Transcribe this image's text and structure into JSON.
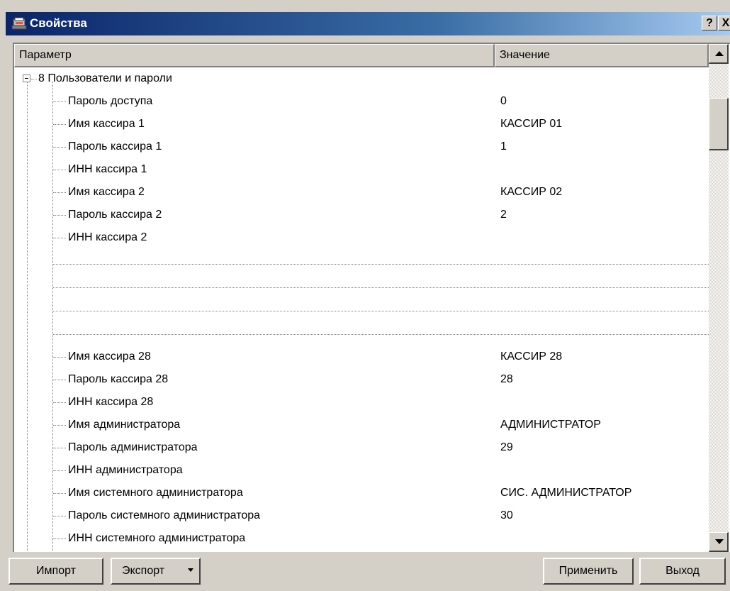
{
  "window": {
    "title": "Свойства",
    "help_label": "?",
    "close_label": "X"
  },
  "table": {
    "columns": [
      "Параметр",
      "Значение"
    ],
    "group": {
      "label": "8 Пользователи и пароли",
      "expanded": true
    },
    "rows_top": [
      {
        "param": "Пароль доступа",
        "value": "0"
      },
      {
        "param": "Имя кассира 1",
        "value": "КАССИР 01"
      },
      {
        "param": "Пароль кассира 1",
        "value": "1"
      },
      {
        "param": "ИНН кассира 1",
        "value": ""
      },
      {
        "param": "Имя кассира 2",
        "value": "КАССИР 02"
      },
      {
        "param": "Пароль кассира 2",
        "value": "2"
      },
      {
        "param": "ИНН кассира 2",
        "value": ""
      }
    ],
    "rows_bottom": [
      {
        "param": "Имя кассира 28",
        "value": "КАССИР 28"
      },
      {
        "param": "Пароль кассира 28",
        "value": "28"
      },
      {
        "param": "ИНН кассира 28",
        "value": ""
      },
      {
        "param": "Имя администратора",
        "value": "АДМИНИСТРАТОР"
      },
      {
        "param": "Пароль администратора",
        "value": "29"
      },
      {
        "param": "ИНН администратора",
        "value": ""
      },
      {
        "param": "Имя системного администратора",
        "value": "СИС. АДМИНИСТРАТОР"
      },
      {
        "param": "Пароль системного администратора",
        "value": "30"
      },
      {
        "param": "ИНН системного администратора",
        "value": ""
      }
    ]
  },
  "buttons": {
    "import": "Импорт",
    "export": "Экспорт",
    "apply": "Применить",
    "exit": "Выход"
  }
}
